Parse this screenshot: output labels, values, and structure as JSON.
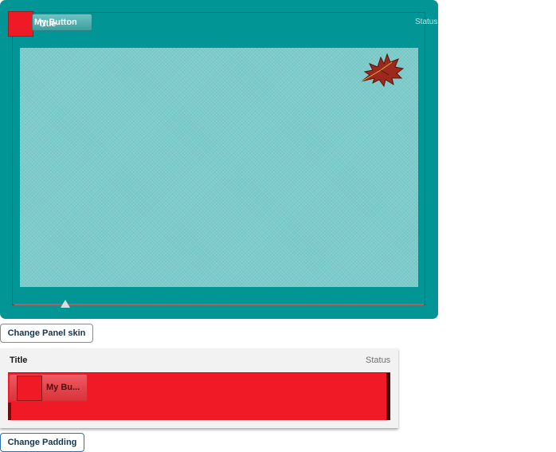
{
  "panel1": {
    "title": "Title",
    "button_label": "My Button",
    "status": "Status"
  },
  "buttons": {
    "change_skin": "Change Panel skin",
    "change_padding": "Change Padding"
  },
  "panel2": {
    "title": "Title",
    "status": "Status",
    "button_label": "My Bu..."
  },
  "colors": {
    "panel_teal": "#029595",
    "content_teal": "#7ccccc",
    "accent_red": "#ef1a25"
  },
  "icons": [
    "maple-leaf-image",
    "slider-thumb-icon"
  ]
}
